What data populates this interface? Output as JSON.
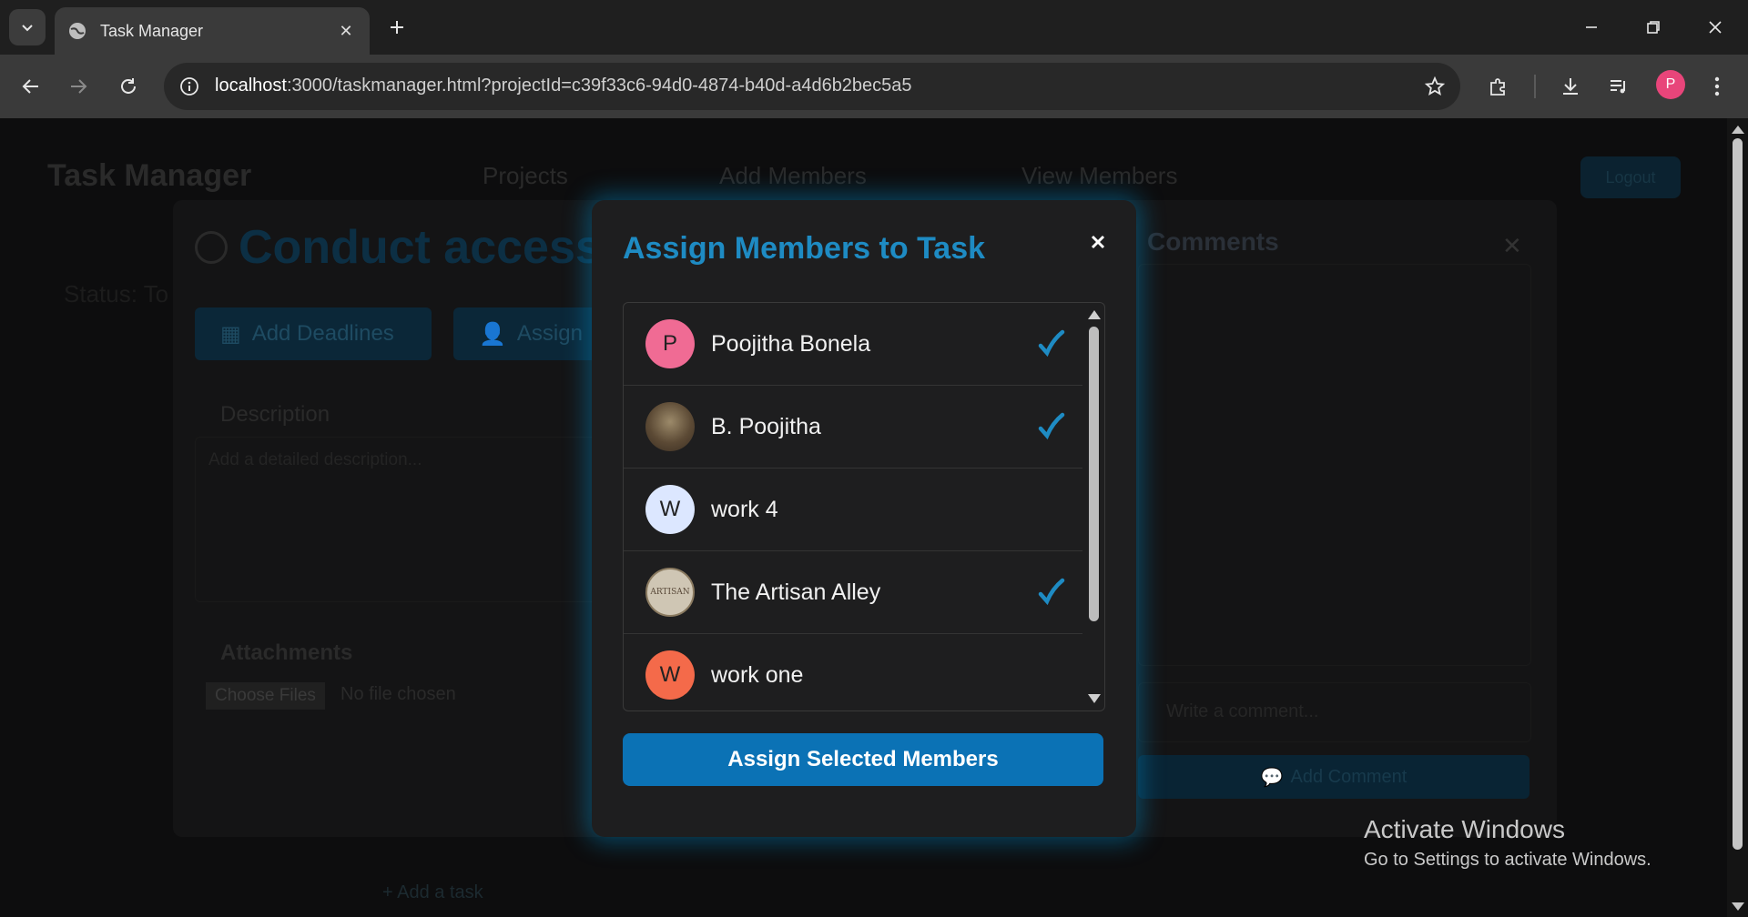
{
  "browser": {
    "tab_title": "Task Manager",
    "url_host": "localhost",
    "url_rest": ":3000/taskmanager.html?projectId=c39f33c6-94d0-4874-b40d-a4d6b2bec5a5",
    "profile_initial": "P"
  },
  "app": {
    "brand": "Task Manager",
    "nav": {
      "projects": "Projects",
      "add_members": "Add Members",
      "view_members": "View Members",
      "logout": "Logout"
    },
    "task": {
      "title": "Conduct access",
      "subtext": "Status: To",
      "add_deadlines": "Add Deadlines",
      "assign": "Assign",
      "description_label": "Description",
      "description_placeholder": "Add a detailed description...",
      "attachments_label": "Attachments",
      "choose_files": "Choose Files",
      "no_file": "No file chosen"
    },
    "comments": {
      "title": "Comments",
      "placeholder": "Write a comment...",
      "add_button": "Add Comment"
    },
    "add_task": "+ Add a task"
  },
  "modal": {
    "title": "Assign Members to Task",
    "members": [
      {
        "name": "Poojitha Bonela",
        "initial": "P",
        "avatar_color": "#f06b94",
        "selected": true,
        "photo": false
      },
      {
        "name": "B. Poojitha",
        "initial": "",
        "avatar_color": "#6b5a45",
        "selected": true,
        "photo": true
      },
      {
        "name": "work 4",
        "initial": "W",
        "avatar_color": "#dce7ff",
        "selected": false,
        "photo": false
      },
      {
        "name": "The Artisan Alley",
        "initial": "",
        "avatar_color": "#cfc6b4",
        "selected": true,
        "photo": true,
        "photo_text": "ARTISAN"
      },
      {
        "name": "work one",
        "initial": "W",
        "avatar_color": "#f46a4a",
        "selected": false,
        "photo": false
      }
    ],
    "assign_button": "Assign Selected Members",
    "accent": "#1e8bc3"
  },
  "watermark": {
    "line1": "Activate Windows",
    "line2": "Go to Settings to activate Windows."
  }
}
